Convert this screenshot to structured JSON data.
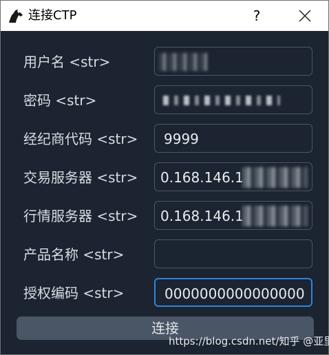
{
  "window": {
    "title": "连接CTP",
    "help_label": "?",
    "close_icon": "close-icon",
    "app_icon": "horse-head-icon"
  },
  "form": {
    "fields": [
      {
        "label": "用户名 <str>",
        "value": ""
      },
      {
        "label": "密码 <str>",
        "value": ""
      },
      {
        "label": "经纪商代码 <str>",
        "value": "9999"
      },
      {
        "label": "交易服务器 <str>",
        "value": "0.168.146.187"
      },
      {
        "label": "行情服务器 <str>",
        "value": "0.168.146.187"
      },
      {
        "label": "产品名称 <str>",
        "value": ""
      },
      {
        "label": "授权编码 <str>",
        "value": "0000000000000000"
      }
    ]
  },
  "connect_button": {
    "label": "连接"
  },
  "watermark": {
    "text": "https://blog.csdn.net/知乎 @亚里"
  },
  "colors": {
    "background": "#1b2430",
    "field_border": "#4a5868",
    "focus_border": "#2e86de",
    "button": "#4a5565"
  }
}
